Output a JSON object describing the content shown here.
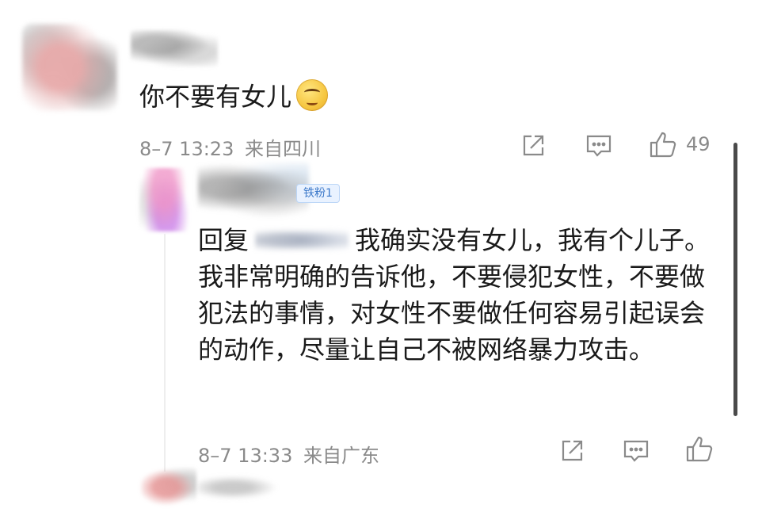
{
  "comment": {
    "text": "你不要有女儿",
    "emoji": "thinking-face-emoji",
    "time": "8–7 13:23",
    "location": "来自四川",
    "likes": "49"
  },
  "reply": {
    "badge": "铁粉1",
    "prefix": "回复",
    "text": "我确实没有女儿，我有个儿子。我非常明确的告诉他，不要侵犯女性，不要做犯法的事情，对女性不要做任何容易引起误会的动作，尽量让自己不被网络暴力攻击。",
    "time": "8–7 13:33",
    "location": "来自广东"
  },
  "icons": {
    "share": "share-icon",
    "comment": "comment-icon",
    "like": "thumbs-up-icon"
  },
  "colors": {
    "meta_text": "#8a8a8a",
    "badge_text": "#3b78c9",
    "badge_bg": "#e9f2ff"
  }
}
